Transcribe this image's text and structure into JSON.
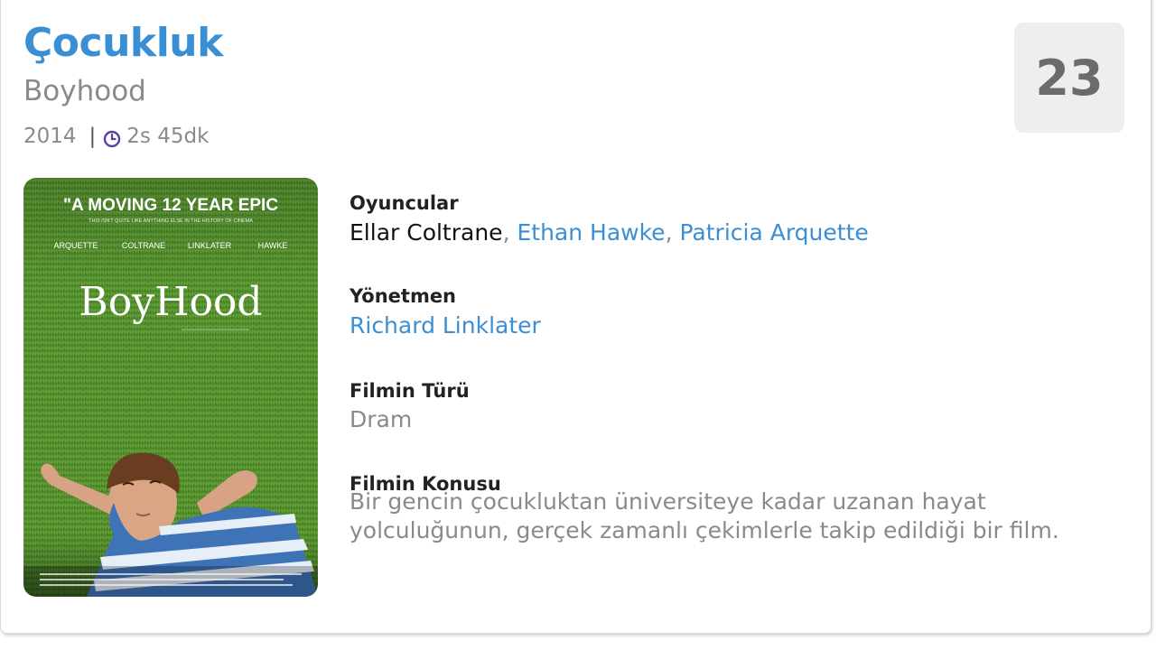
{
  "movie": {
    "title": "Çocukluk",
    "original_title": "Boyhood",
    "year": "2014",
    "separator": "|",
    "duration": "2s 45dk",
    "score": "23"
  },
  "poster": {
    "tagline": "\"A MOVING 12 YEAR EPIC",
    "sub_tagline": "THIS ISN'T QUITE LIKE ANYTHING ELSE IN THE HISTORY OF CINEMA",
    "credits": [
      "ARQUETTE",
      "COLTRANE",
      "LINKLATER",
      "HAWKE"
    ],
    "wordmark": "BoyHood"
  },
  "details": {
    "cast_label": "Oyuncular",
    "cast": [
      {
        "name": "Ellar Coltrane",
        "linked": false
      },
      {
        "name": "Ethan Hawke",
        "linked": true
      },
      {
        "name": "Patricia Arquette",
        "linked": true
      }
    ],
    "cast_separator": ", ",
    "director_label": "Yönetmen",
    "director": "Richard Linklater",
    "genre_label": "Filmin Türü",
    "genre": "Dram",
    "plot_label": "Filmin Konusu",
    "plot": "Bir gencin çocukluktan üniversiteye kadar uzanan hayat yolculuğunun, gerçek zamanlı çekimlerle takip edildiği bir film."
  },
  "colors": {
    "link": "#3a8fd4",
    "muted": "#8a8a8a",
    "score_bg": "#eeeeee",
    "clock_icon": "#5b3fa8"
  },
  "icons": {
    "duration": "clock-icon"
  }
}
